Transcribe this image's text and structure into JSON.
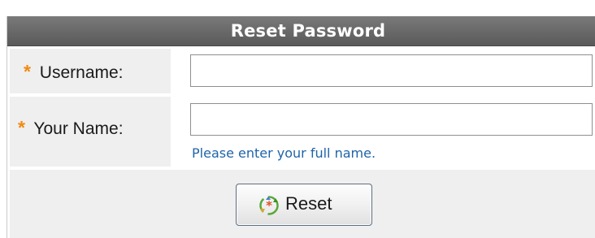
{
  "form": {
    "title": "Reset Password",
    "required_marker": "*",
    "fields": [
      {
        "label": "Username:",
        "value": "",
        "placeholder": ""
      },
      {
        "label": "Your Name:",
        "value": "",
        "placeholder": "",
        "hint": "Please enter your full name."
      }
    ],
    "submit": {
      "label": "Reset",
      "icon": "reset-icon"
    }
  },
  "colors": {
    "title_bar": "#6b6b6b",
    "required_marker": "#f28a0f",
    "hint_text": "#1e64a8",
    "label_background": "#efefef"
  }
}
